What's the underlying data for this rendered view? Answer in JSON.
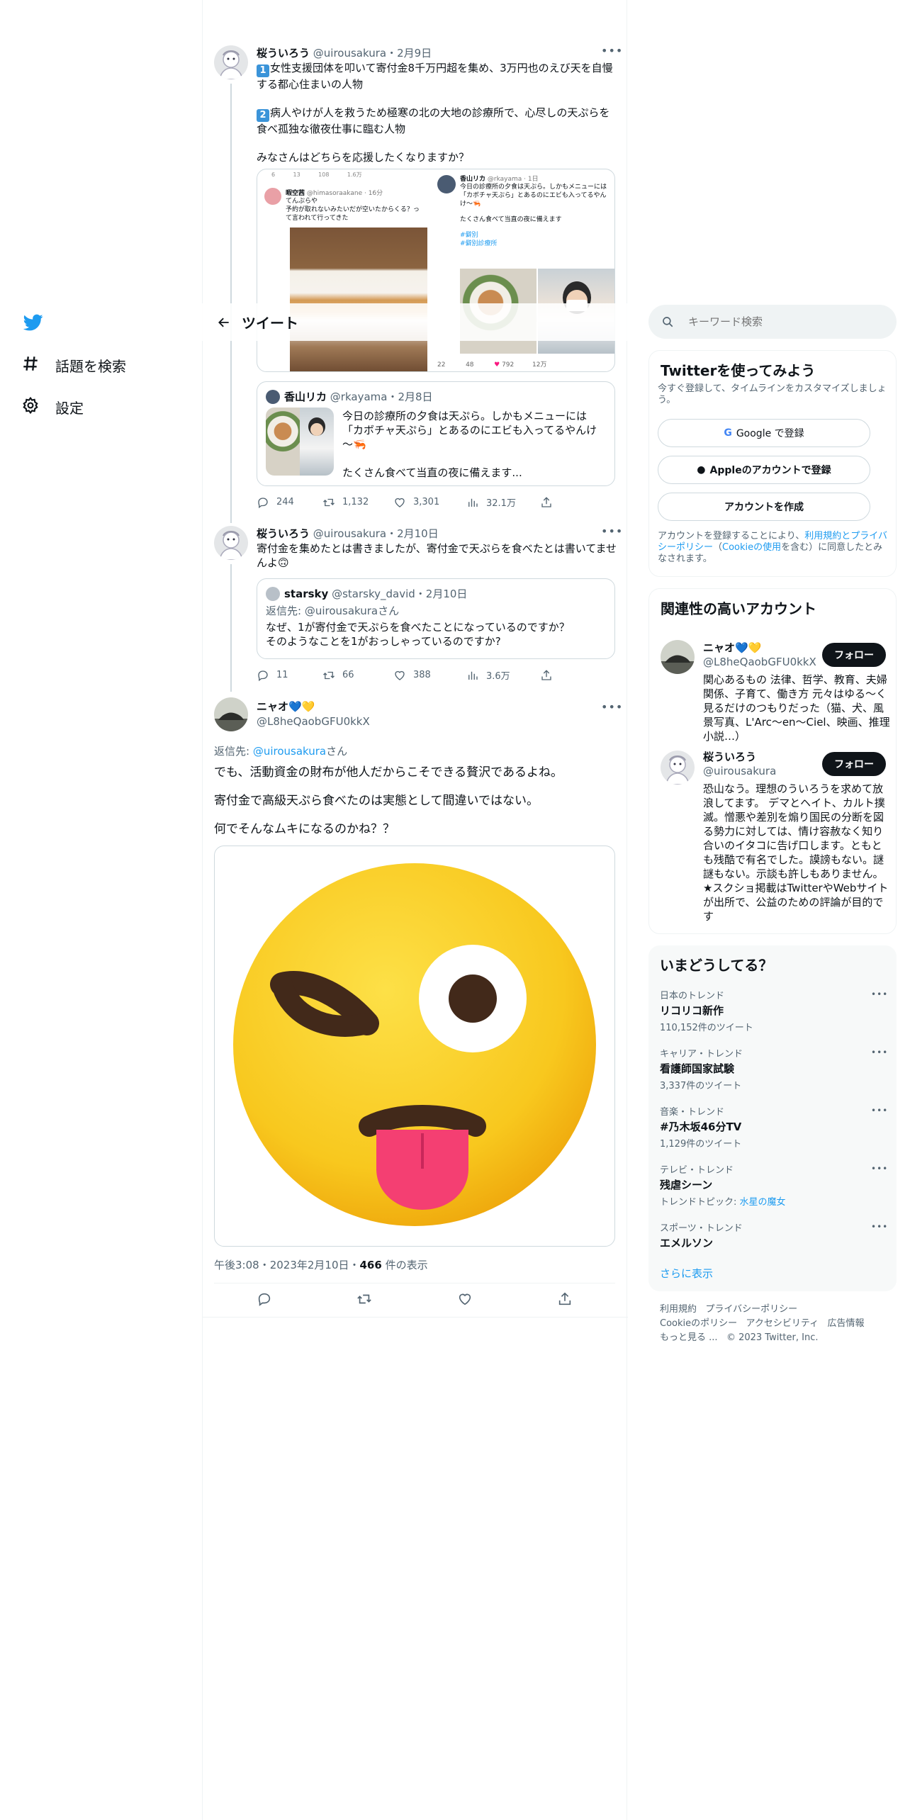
{
  "nav": {
    "explore_label": "話題を検索",
    "settings_label": "設定"
  },
  "header": {
    "title": "ツイート"
  },
  "thread": [
    {
      "name": "桜ういろう",
      "handle": "@uirousakura",
      "date": "・2月9日",
      "body_1_num": "1",
      "body_1": "女性支援団体を叩いて寄付金8千万円超を集め、3万円也のえび天を自慢する都心住まいの人物",
      "body_2_num": "2",
      "body_2": "病人やけが人を救うため極寒の北の大地の診療所で、心尽しの天ぷらを食べ孤独な徹夜仕事に臨む人物",
      "body_3": "みなさんはどちらを応援したくなりますか？",
      "image": {
        "left_name": "暇空茜",
        "left_handle": "@himasoraakane · 16分",
        "left_text_1": "てんぷらや",
        "left_text_2": "予約が取れないみたいだが空いたからくる？って言われて行ってきた",
        "right_name": "香山リカ",
        "right_handle": "@rkayama · 1日",
        "right_text": "今日の診療所の夕食は天ぷら。しかもメニューには「カボチャ天ぷら」とあるのにエビも入ってるやんけ～🦐",
        "right_text_2": "たくさん食べて当直の夜に備えます",
        "right_tag_1": "#僻別",
        "right_tag_2": "#僻別診療所",
        "right_stat_1": "22",
        "right_stat_2": "48",
        "right_stat_3": "792",
        "right_stat_4": "12万",
        "top_stat_1": "6",
        "top_stat_2": "13",
        "top_stat_3": "108",
        "top_stat_4": "1.6万"
      },
      "quote": {
        "name": "香山リカ",
        "handle": "@rkayama",
        "date": "・2月8日",
        "text": "今日の診療所の夕食は天ぷら。しかもメニューには「カボチャ天ぷら」とあるのにエビも入ってるやんけ～🦐",
        "text_2": "たくさん食べて当直の夜に備えます..."
      },
      "stats": {
        "replies": "244",
        "retweets": "1,132",
        "likes": "3,301",
        "views": "32.1万"
      }
    },
    {
      "name": "桜ういろう",
      "handle": "@uirousakura",
      "date": "・2月10日",
      "body": "寄付金を集めたとは書きましたが、寄付金で天ぷらを食べたとは書いてませんよ🙃",
      "quote": {
        "name": "starsky",
        "handle": "@starsky_david",
        "date": "・2月10日",
        "reply_to_label": "返信先: ",
        "reply_to": "@uirousakura",
        "reply_suffix": "さん",
        "text": "なぜ、1が寄付金で天ぷらを食べたことになっているのですか？",
        "text_2": "そのようなことを1がおっしゃっているのですか?"
      },
      "stats": {
        "replies": "11",
        "retweets": "66",
        "likes": "388",
        "views": "3.6万"
      }
    }
  ],
  "main_tweet": {
    "name": "ニャオ💙💛",
    "handle": "@L8heQaobGFU0kkX",
    "reply_label": "返信先: ",
    "reply_to": "@uirousakura",
    "reply_suffix": "さん",
    "line_1": "でも、活動資金の財布が他人だからこそできる贅沢であるよね。",
    "line_2": "寄付金で高級天ぷら食べたのは実態として間違いではない。",
    "line_3": "何でそんなムキになるのかね？？",
    "image_alt": "winking-face-with-tongue-emoji",
    "time": "午後3:08",
    "date": "・2023年2月10日・",
    "views_count": "466",
    "views_label": " 件の表示"
  },
  "search": {
    "placeholder": "キーワード検索"
  },
  "signup": {
    "title": "Twitterを使ってみよう",
    "subtitle": "今すぐ登録して、タイムラインをカスタマイズしましょう。",
    "google_label": "Google で登録",
    "apple_label": "Appleのアカウントで登録",
    "create_label": "アカウントを作成",
    "terms_1": "アカウントを登録することにより、",
    "terms_link_1": "利用規約とプライバシーポリシー",
    "terms_2": "（",
    "terms_link_2": "Cookieの使用",
    "terms_3": "を含む）に同意したとみなされます。"
  },
  "related": {
    "title": "関連性の高いアカウント",
    "accounts": [
      {
        "name": "ニャオ💙💛",
        "handle": "@L8heQaobGFU0kkX",
        "follow": "フォロー",
        "bio": "関心あるもの 法律、哲学、教育、夫婦関係、子育て、働き方 元々はゆる〜く見るだけのつもりだった（猫、犬、風景写真、L'Arc～en～Ciel、映画、推理小説…）"
      },
      {
        "name": "桜ういろう",
        "handle": "@uirousakura",
        "follow": "フォロー",
        "bio": "恐山なう。理想のういろうを求めて放浪してます。 デマとヘイト、カルト撲滅。憎悪や差別を煽り国民の分断を図る勢力に対しては、情け容赦なく知り合いのイタコに告げ口します。ともとも残酷で有名でした。謨謗もない。謎謎もない。示談も許しもありません。★スクショ掲載はTwitterやWebサイトが出所で、公益のための評論が目的です"
      }
    ]
  },
  "trends": {
    "title": "いまどうしてる？",
    "items": [
      {
        "category": "日本のトレンド",
        "name": "リコリコ新作",
        "count": "110,152件のツイート"
      },
      {
        "category": "キャリア・トレンド",
        "name": "看護師国家試験",
        "count": "3,337件のツイート"
      },
      {
        "category": "音楽・トレンド",
        "name": "#乃木坂46分TV",
        "count": "1,129件のツイート"
      },
      {
        "category": "テレビ・トレンド",
        "name": "残虐シーン",
        "count_prefix": "トレンドトピック: ",
        "count_link": "水星の魔女"
      },
      {
        "category": "スポーツ・トレンド",
        "name": "エメルソン"
      }
    ],
    "show_more": "さらに表示"
  },
  "footer": {
    "terms": "利用規約",
    "privacy": "プライバシーポリシー",
    "cookies": "Cookieのポリシー",
    "accessibility": "アクセシビリティ",
    "ads": "広告情報",
    "more": "もっと見る ...",
    "copyright": "© 2023 Twitter, Inc."
  },
  "colors": {
    "brand": "#1d9bf0",
    "text": "#0f1419",
    "muted": "#536471",
    "border": "#cfd9de",
    "card_bg": "#f7f9f9",
    "like_pink": "#f91880"
  }
}
